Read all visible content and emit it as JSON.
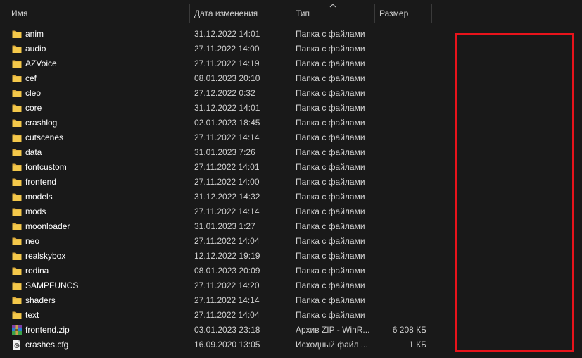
{
  "columns": {
    "name": "Имя",
    "date": "Дата изменения",
    "type": "Тип",
    "size": "Размер"
  },
  "rows": [
    {
      "name": "anim",
      "date": "31.12.2022 14:01",
      "type": "Папка с файлами",
      "size": "",
      "icon": "folder-icon"
    },
    {
      "name": "audio",
      "date": "27.11.2022 14:00",
      "type": "Папка с файлами",
      "size": "",
      "icon": "folder-icon"
    },
    {
      "name": "AZVoice",
      "date": "27.11.2022 14:19",
      "type": "Папка с файлами",
      "size": "",
      "icon": "folder-icon"
    },
    {
      "name": "cef",
      "date": "08.01.2023 20:10",
      "type": "Папка с файлами",
      "size": "",
      "icon": "folder-icon"
    },
    {
      "name": "cleo",
      "date": "27.12.2022 0:32",
      "type": "Папка с файлами",
      "size": "",
      "icon": "folder-icon"
    },
    {
      "name": "core",
      "date": "31.12.2022 14:01",
      "type": "Папка с файлами",
      "size": "",
      "icon": "folder-icon"
    },
    {
      "name": "crashlog",
      "date": "02.01.2023 18:45",
      "type": "Папка с файлами",
      "size": "",
      "icon": "folder-icon"
    },
    {
      "name": "cutscenes",
      "date": "27.11.2022 14:14",
      "type": "Папка с файлами",
      "size": "",
      "icon": "folder-icon"
    },
    {
      "name": "data",
      "date": "31.01.2023 7:26",
      "type": "Папка с файлами",
      "size": "",
      "icon": "folder-icon"
    },
    {
      "name": "fontcustom",
      "date": "27.11.2022 14:01",
      "type": "Папка с файлами",
      "size": "",
      "icon": "folder-icon"
    },
    {
      "name": "frontend",
      "date": "27.11.2022 14:00",
      "type": "Папка с файлами",
      "size": "",
      "icon": "folder-icon"
    },
    {
      "name": "models",
      "date": "31.12.2022 14:32",
      "type": "Папка с файлами",
      "size": "",
      "icon": "folder-icon"
    },
    {
      "name": "mods",
      "date": "27.11.2022 14:14",
      "type": "Папка с файлами",
      "size": "",
      "icon": "folder-icon"
    },
    {
      "name": "moonloader",
      "date": "31.01.2023 1:27",
      "type": "Папка с файлами",
      "size": "",
      "icon": "folder-icon"
    },
    {
      "name": "neo",
      "date": "27.11.2022 14:04",
      "type": "Папка с файлами",
      "size": "",
      "icon": "folder-icon"
    },
    {
      "name": "realskybox",
      "date": "12.12.2022 19:19",
      "type": "Папка с файлами",
      "size": "",
      "icon": "folder-icon"
    },
    {
      "name": "rodina",
      "date": "08.01.2023 20:09",
      "type": "Папка с файлами",
      "size": "",
      "icon": "folder-icon"
    },
    {
      "name": "SAMPFUNCS",
      "date": "27.11.2022 14:20",
      "type": "Папка с файлами",
      "size": "",
      "icon": "folder-icon"
    },
    {
      "name": "shaders",
      "date": "27.11.2022 14:14",
      "type": "Папка с файлами",
      "size": "",
      "icon": "folder-icon"
    },
    {
      "name": "text",
      "date": "27.11.2022 14:04",
      "type": "Папка с файлами",
      "size": "",
      "icon": "folder-icon"
    },
    {
      "name": "frontend.zip",
      "date": "03.01.2023 23:18",
      "type": "Архив ZIP - WinR...",
      "size": "6 208 КБ",
      "icon": "winrar-archive-icon"
    },
    {
      "name": "crashes.cfg",
      "date": "16.09.2020 13:05",
      "type": "Исходный файл ...",
      "size": "1 КБ",
      "icon": "cfg-file-icon"
    }
  ],
  "colors": {
    "background": "#191919",
    "folder": "#f4c84a",
    "highlight_box": "#e8131b"
  }
}
